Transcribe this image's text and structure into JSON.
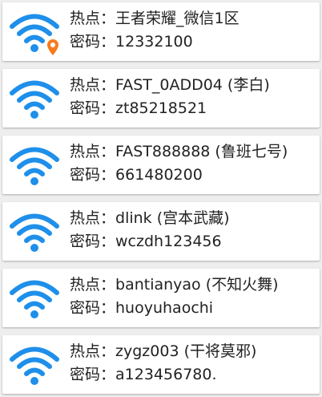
{
  "colors": {
    "wifi_icon": "#1e8fea",
    "location_pin": "#f57c1f",
    "text": "#222222",
    "card": "#ffffff",
    "background": "#eeeeee"
  },
  "labels": {
    "ssid_prefix": "热点：",
    "password_prefix": "密码："
  },
  "networks": [
    {
      "ssid": "王者荣耀_微信1区",
      "password": "12332100",
      "icon": "wifi-icon",
      "badge": "location-pin-icon"
    },
    {
      "ssid": "FAST_0ADD04 (李白)",
      "password": "zt85218521",
      "icon": "wifi-icon"
    },
    {
      "ssid": "FAST888888 (鲁班七号)",
      "password": "661480200",
      "icon": "wifi-icon"
    },
    {
      "ssid": "dlink (宫本武藏)",
      "password": "wczdh123456",
      "icon": "wifi-icon"
    },
    {
      "ssid": "bantianyao (不知火舞)",
      "password": "huoyuhaochi",
      "icon": "wifi-icon"
    },
    {
      "ssid": "zygz003 (干将莫邪)",
      "password": "a123456780.",
      "icon": "wifi-icon"
    }
  ]
}
